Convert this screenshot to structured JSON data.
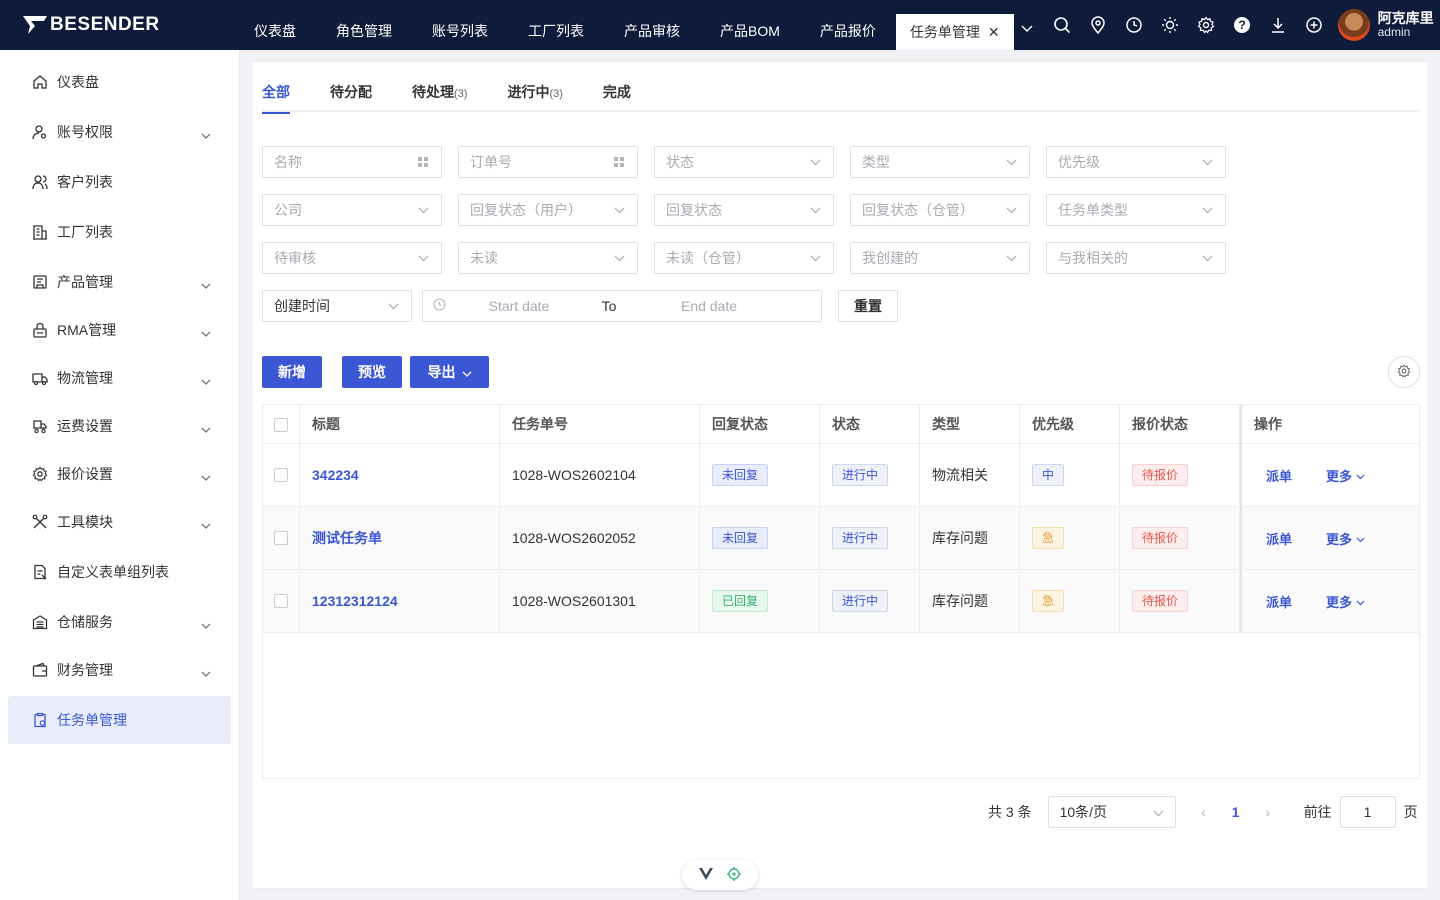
{
  "brand": {
    "name": "BESENDER",
    "bar_color": "#0f1b3a",
    "accent": "#3b57d6"
  },
  "topnav": {
    "items": [
      "仪表盘",
      "角色管理",
      "账号列表",
      "工厂列表",
      "产品审核",
      "产品BOM",
      "产品报价"
    ],
    "active_tab": "任务单管理",
    "icons": [
      "search-icon",
      "location-icon",
      "clock-icon",
      "sun-icon",
      "gear-icon",
      "help-icon",
      "download-icon",
      "plus-circle-icon"
    ]
  },
  "user": {
    "name": "阿克库里",
    "role": "admin"
  },
  "sidebar": {
    "items": [
      {
        "label": "仪表盘",
        "icon": "home-icon",
        "expandable": false
      },
      {
        "label": "账号权限",
        "icon": "user-key-icon",
        "expandable": true
      },
      {
        "label": "客户列表",
        "icon": "users-icon",
        "expandable": false
      },
      {
        "label": "工厂列表",
        "icon": "building-icon",
        "expandable": false
      },
      {
        "label": "产品管理",
        "icon": "box-icon",
        "expandable": true
      },
      {
        "label": "RMA管理",
        "icon": "lock-box-icon",
        "expandable": true
      },
      {
        "label": "物流管理",
        "icon": "truck-icon",
        "expandable": true
      },
      {
        "label": "运费设置",
        "icon": "shipping-icon",
        "expandable": true
      },
      {
        "label": "报价设置",
        "icon": "settings-icon",
        "expandable": true
      },
      {
        "label": "工具模块",
        "icon": "tools-icon",
        "expandable": true
      },
      {
        "label": "自定义表单组列表",
        "icon": "form-icon",
        "expandable": false
      },
      {
        "label": "仓储服务",
        "icon": "warehouse-icon",
        "expandable": true
      },
      {
        "label": "财务管理",
        "icon": "wallet-icon",
        "expandable": true
      },
      {
        "label": "任务单管理",
        "icon": "task-icon",
        "expandable": false,
        "active": true
      }
    ]
  },
  "tabs": [
    {
      "label": "全部",
      "count": ""
    },
    {
      "label": "待分配",
      "count": ""
    },
    {
      "label": "待处理",
      "count": "(3)"
    },
    {
      "label": "进行中",
      "count": "(3)"
    },
    {
      "label": "完成",
      "count": ""
    }
  ],
  "filters": {
    "row1": [
      "名称",
      "订单号",
      "状态",
      "类型",
      "优先级"
    ],
    "row2": [
      "公司",
      "回复状态（用户）",
      "回复状态",
      "回复状态（仓管）",
      "任务单类型"
    ],
    "row3": [
      "待审核",
      "未读",
      "未读（仓管）",
      "我创建的",
      "与我相关的"
    ],
    "time_field": "创建时间",
    "date_start": "Start date",
    "date_to": "To",
    "date_end": "End date",
    "reset": "重置"
  },
  "actions": {
    "add": "新增",
    "preview": "预览",
    "export": "导出"
  },
  "table": {
    "headers": [
      "标题",
      "任务单号",
      "回复状态",
      "状态",
      "类型",
      "优先级",
      "报价状态",
      "操作"
    ],
    "rows": [
      {
        "title": "342234",
        "no": "1028-WOS2602104",
        "reply": "未回复",
        "reply_color": "blue",
        "status": "进行中",
        "type": "物流相关",
        "priority": "中",
        "priority_color": "gray",
        "quote": "待报价",
        "op_assign": "派单",
        "op_more": "更多"
      },
      {
        "title": "测试任务单",
        "no": "1028-WOS2602052",
        "reply": "未回复",
        "reply_color": "blue",
        "status": "进行中",
        "type": "库存问题",
        "priority": "急",
        "priority_color": "orange",
        "quote": "待报价",
        "op_assign": "派单",
        "op_more": "更多"
      },
      {
        "title": "12312312124",
        "no": "1028-WOS2601301",
        "reply": "已回复",
        "reply_color": "green",
        "status": "进行中",
        "type": "库存问题",
        "priority": "急",
        "priority_color": "orange",
        "quote": "待报价",
        "op_assign": "派单",
        "op_more": "更多"
      }
    ]
  },
  "pagination": {
    "total": "共 3 条",
    "page_size": "10条/页",
    "current": "1",
    "goto_label": "前往",
    "goto_value": "1",
    "page_suffix": "页"
  }
}
